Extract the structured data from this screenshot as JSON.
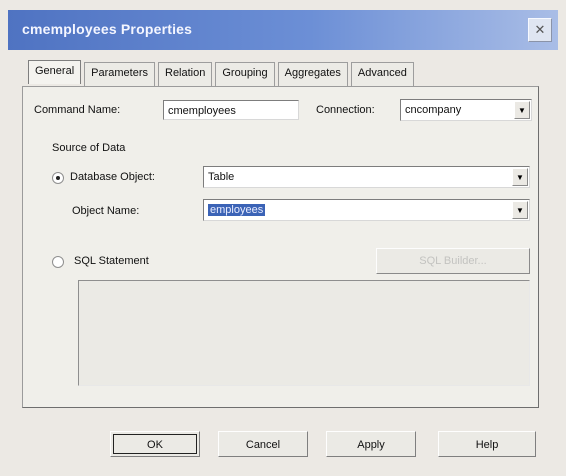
{
  "window": {
    "title": "cmemployees Properties"
  },
  "tabs": [
    {
      "label": "General",
      "active": true
    },
    {
      "label": "Parameters",
      "active": false
    },
    {
      "label": "Relation",
      "active": false
    },
    {
      "label": "Grouping",
      "active": false
    },
    {
      "label": "Aggregates",
      "active": false
    },
    {
      "label": "Advanced",
      "active": false
    }
  ],
  "general": {
    "command_name_label": "Command Name:",
    "command_name_value": "cmemployees",
    "connection_label": "Connection:",
    "connection_value": "cncompany",
    "source_group_label": "Source of Data",
    "database_object_label": "Database Object:",
    "database_object_value": "Table",
    "database_object_selected": true,
    "object_name_label": "Object Name:",
    "object_name_value": "employees",
    "sql_statement_label": "SQL Statement",
    "sql_statement_selected": false,
    "sql_builder_label": "SQL Builder..."
  },
  "buttons": {
    "ok": "OK",
    "cancel": "Cancel",
    "apply": "Apply",
    "help": "Help"
  },
  "colors": {
    "title_bar_start": "#4f73c2",
    "title_bar_end": "#a9bde6",
    "selection": "#3b63b6"
  }
}
